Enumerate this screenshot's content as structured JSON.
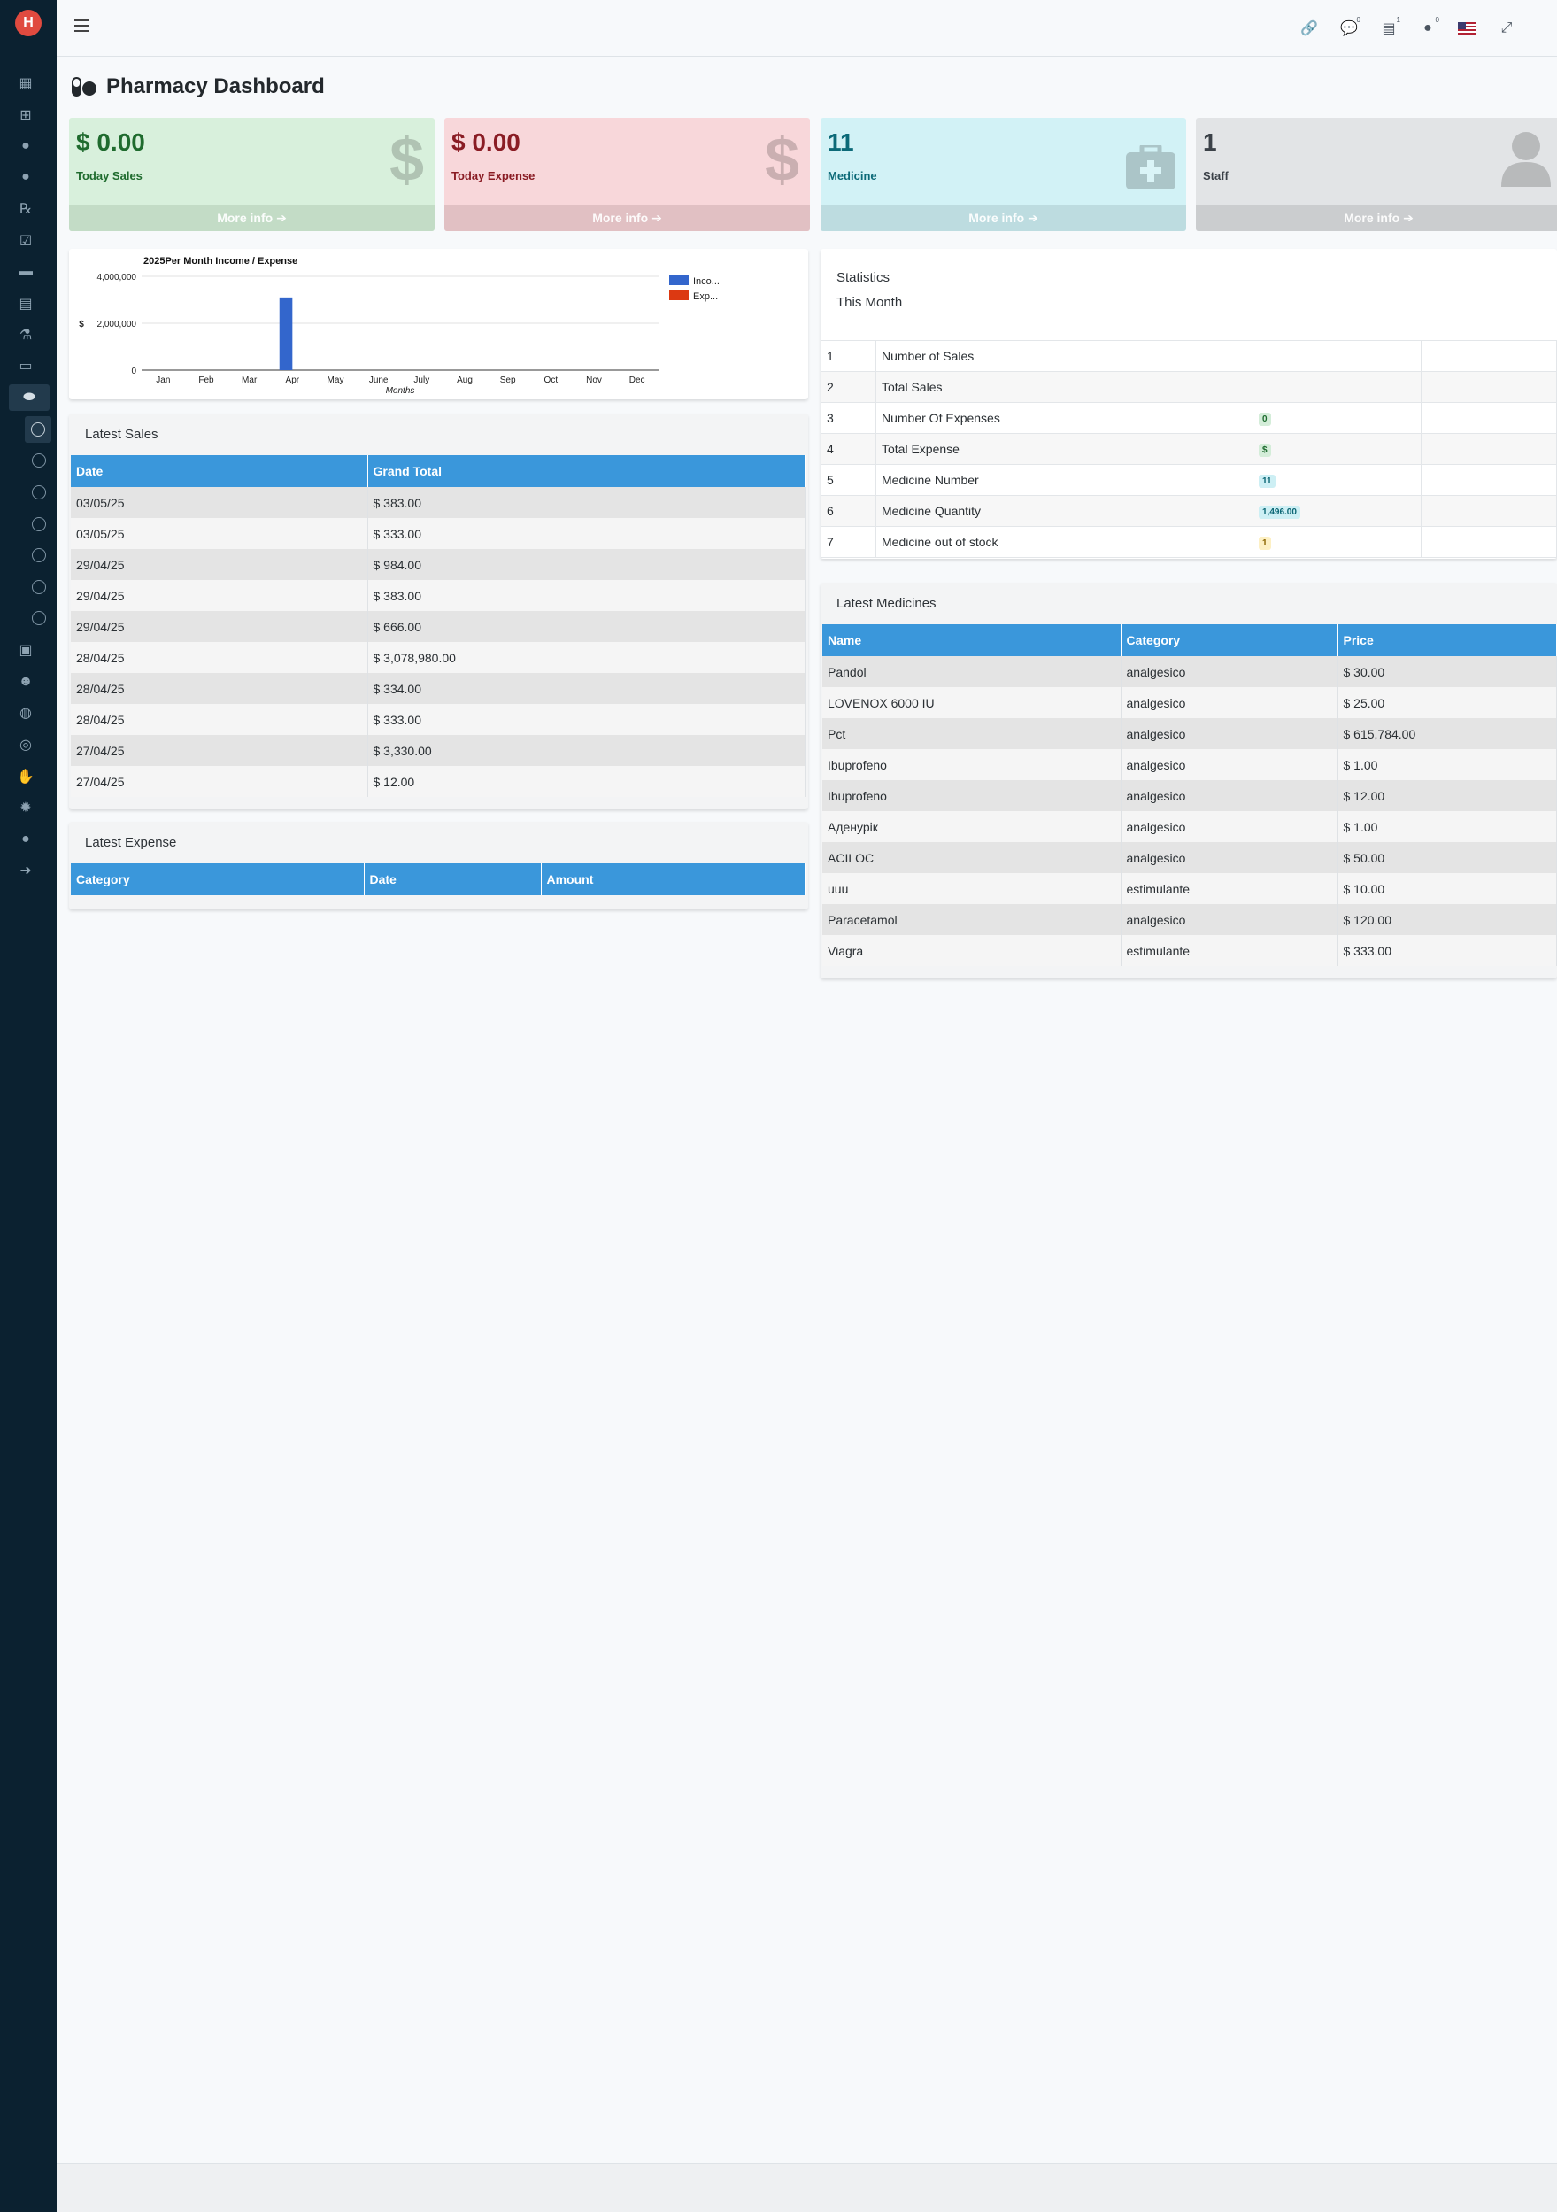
{
  "page": {
    "title": "Pharmacy Dashboard"
  },
  "info_boxes": [
    {
      "value": "$ 0.00",
      "label": "Today Sales",
      "footer": "More info",
      "icon": "dollar-icon"
    },
    {
      "value": "$ 0.00",
      "label": "Today Expense",
      "footer": "More info",
      "icon": "dollar-icon"
    },
    {
      "value": "11",
      "label": "Medicine",
      "footer": "More info",
      "icon": "medkit-icon"
    },
    {
      "value": "1",
      "label": "Staff",
      "footer": "More info",
      "icon": "user-icon"
    }
  ],
  "topbar": {
    "icons": [
      "link-icon",
      "comments-icon",
      "money-card-icon",
      "user-notify-icon",
      "us-flag-icon",
      "fullscreen-icon",
      "logout-icon"
    ],
    "badges": [
      "0",
      "1",
      "0"
    ]
  },
  "sidebar": {
    "icons": [
      "dashboard-icon",
      "sitemap-icon",
      "doctor-icon",
      "patient-icon",
      "prescription-icon",
      "appointment-icon",
      "payment-icon",
      "report-icon",
      "lab-icon",
      "bed-icon",
      "pharmacy-icon",
      "ambulance-icon",
      "users-icon",
      "chat-icon",
      "website-icon",
      "donor-icon",
      "settings-icon",
      "profile-icon",
      "logout-icon"
    ]
  },
  "chart_data": {
    "type": "bar",
    "title": "2025Per Month Income / Expense",
    "xlabel": "Months",
    "ylabel": "$",
    "categories": [
      "Jan",
      "Feb",
      "Mar",
      "Apr",
      "May",
      "June",
      "July",
      "Aug",
      "Sep",
      "Oct",
      "Nov",
      "Dec"
    ],
    "series": [
      {
        "name": "Inco...",
        "color": "#3366cc",
        "values": [
          0,
          0,
          0,
          3100000,
          0,
          0,
          0,
          0,
          0,
          0,
          0,
          0
        ]
      },
      {
        "name": "Exp...",
        "color": "#dc3912",
        "values": [
          0,
          0,
          0,
          0,
          0,
          0,
          0,
          0,
          0,
          0,
          0,
          0
        ]
      }
    ],
    "ylim": [
      0,
      4000000
    ],
    "yticks": [
      "0",
      "2,000,000",
      "4,000,000"
    ],
    "legend": "right",
    "grid": true
  },
  "latest_sales": {
    "title": "Latest Sales",
    "columns": [
      "Date",
      "Grand Total"
    ],
    "rows": [
      [
        "03/05/25",
        "$ 383.00"
      ],
      [
        "03/05/25",
        "$ 333.00"
      ],
      [
        "29/04/25",
        "$ 984.00"
      ],
      [
        "29/04/25",
        "$ 383.00"
      ],
      [
        "29/04/25",
        "$ 666.00"
      ],
      [
        "28/04/25",
        "$ 3,078,980.00"
      ],
      [
        "28/04/25",
        "$ 334.00"
      ],
      [
        "28/04/25",
        "$ 333.00"
      ],
      [
        "27/04/25",
        "$ 3,330.00"
      ],
      [
        "27/04/25",
        "$ 12.00"
      ]
    ]
  },
  "latest_expense": {
    "title": "Latest Expense",
    "columns": [
      "Category",
      "Date",
      "Amount"
    ]
  },
  "statistics": {
    "title": "Statistics",
    "subtitle": "This Month",
    "rows": [
      {
        "n": "1",
        "label": "Number of Sales",
        "value": "",
        "badge": ""
      },
      {
        "n": "2",
        "label": "Total Sales",
        "value": "",
        "badge": ""
      },
      {
        "n": "3",
        "label": "Number Of Expenses",
        "value": "0",
        "badge": "green"
      },
      {
        "n": "4",
        "label": "Total Expense",
        "value": "$",
        "badge": "green"
      },
      {
        "n": "5",
        "label": "Medicine Number",
        "value": "11",
        "badge": "cyan"
      },
      {
        "n": "6",
        "label": "Medicine Quantity",
        "value": "1,496.00",
        "badge": "cyan"
      },
      {
        "n": "7",
        "label": "Medicine out of stock",
        "value": "1",
        "badge": "yellow"
      }
    ]
  },
  "latest_medicines": {
    "title": "Latest Medicines",
    "columns": [
      "Name",
      "Category",
      "Price"
    ],
    "rows": [
      [
        "Pandol",
        "analgesico",
        "$ 30.00"
      ],
      [
        "LOVENOX 6000 IU",
        "analgesico",
        "$ 25.00"
      ],
      [
        "Pct",
        "analgesico",
        "$ 615,784.00"
      ],
      [
        "Ibuprofeno",
        "analgesico",
        "$ 1.00"
      ],
      [
        "Ibuprofeno",
        "analgesico",
        "$ 12.00"
      ],
      [
        "Аденурік",
        "analgesico",
        "$ 1.00"
      ],
      [
        "ACILOC",
        "analgesico",
        "$ 50.00"
      ],
      [
        "uuu",
        "estimulante",
        "$ 10.00"
      ],
      [
        "Paracetamol",
        "analgesico",
        "$ 120.00"
      ],
      [
        "Viagra",
        "estimulante",
        "$ 333.00"
      ]
    ]
  }
}
